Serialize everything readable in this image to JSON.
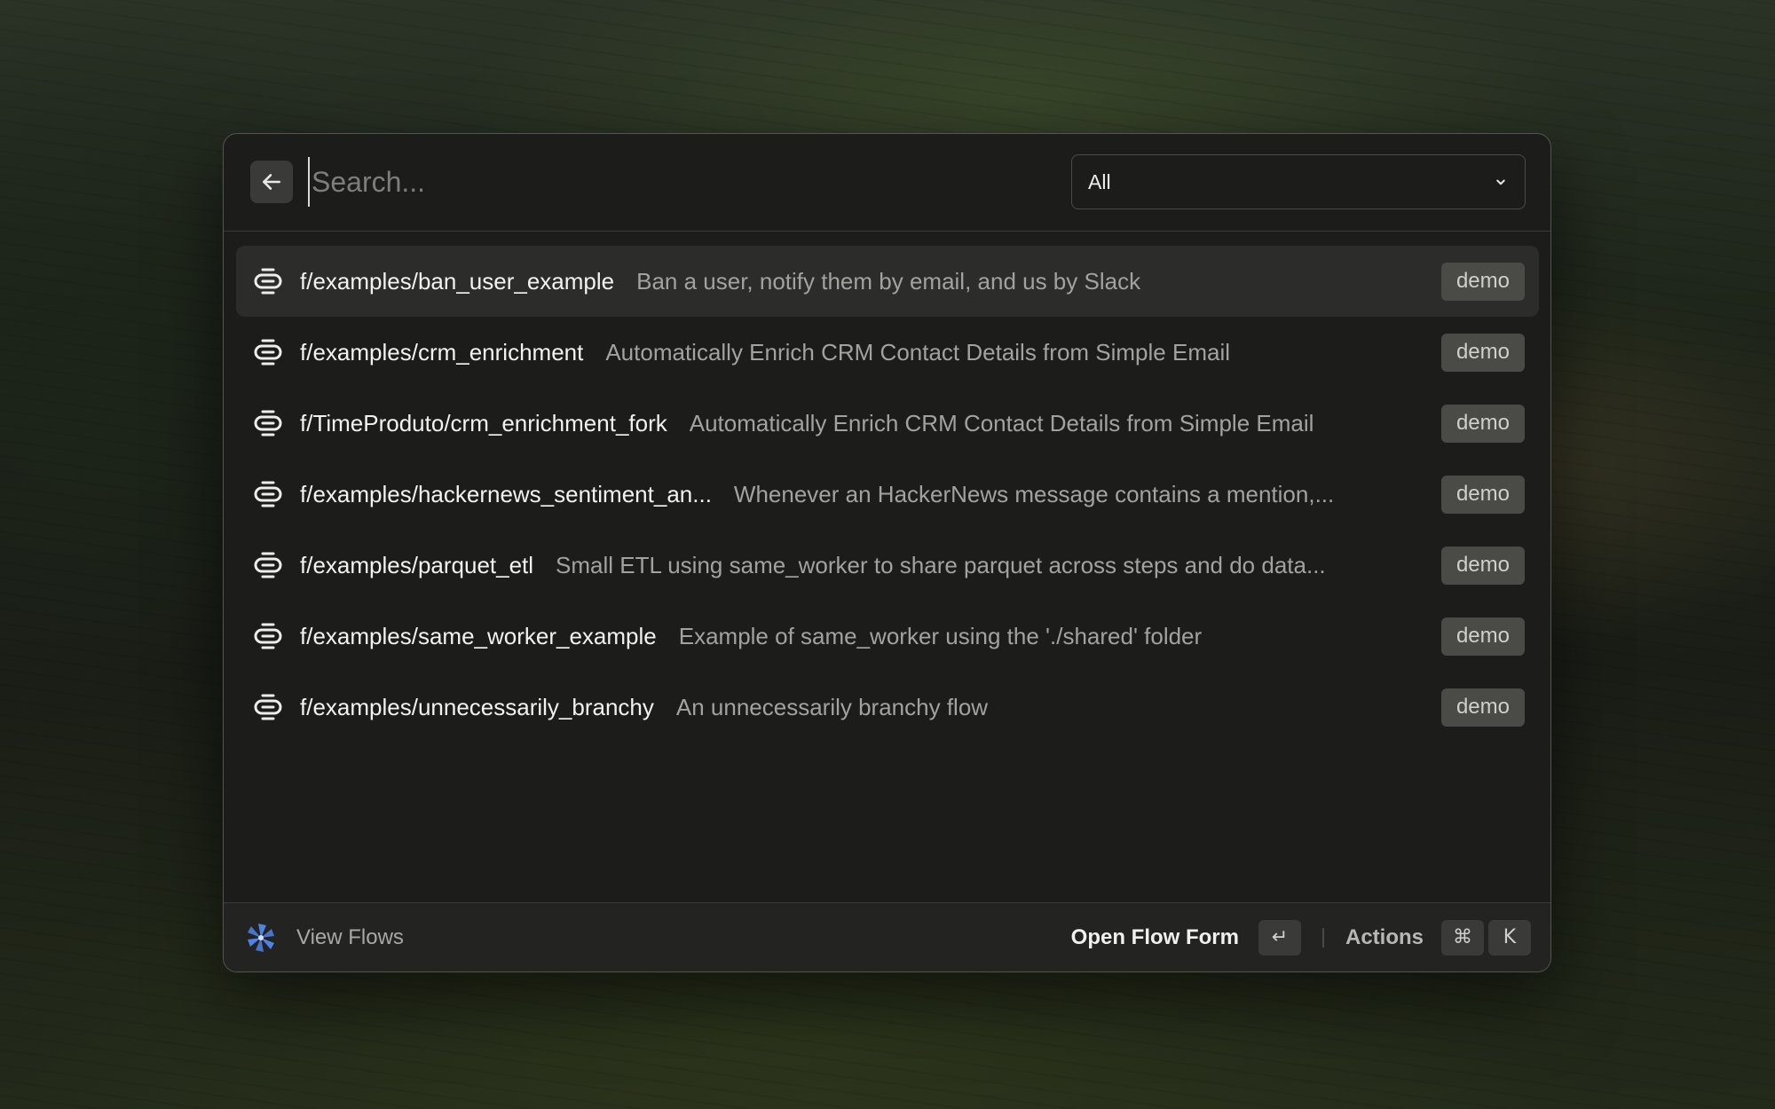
{
  "search": {
    "placeholder": "Search...",
    "value": ""
  },
  "filter": {
    "selected": "All"
  },
  "results": [
    {
      "path": "f/examples/ban_user_example",
      "description": "Ban a user, notify them by email, and us by Slack",
      "badge": "demo",
      "selected": true
    },
    {
      "path": "f/examples/crm_enrichment",
      "description": "Automatically Enrich CRM Contact Details from Simple Email",
      "badge": "demo",
      "selected": false
    },
    {
      "path": "f/TimeProduto/crm_enrichment_fork",
      "description": "Automatically Enrich CRM Contact Details from Simple Email",
      "badge": "demo",
      "selected": false
    },
    {
      "path": "f/examples/hackernews_sentiment_an...",
      "description": "Whenever an HackerNews message contains a mention,...",
      "badge": "demo",
      "selected": false
    },
    {
      "path": "f/examples/parquet_etl",
      "description": "Small ETL using same_worker to share parquet across steps and do data...",
      "badge": "demo",
      "selected": false
    },
    {
      "path": "f/examples/same_worker_example",
      "description": "Example of same_worker using the './shared' folder",
      "badge": "demo",
      "selected": false
    },
    {
      "path": "f/examples/unnecessarily_branchy",
      "description": "An unnecessarily branchy flow",
      "badge": "demo",
      "selected": false
    }
  ],
  "footer": {
    "title": "View Flows",
    "primary_action": "Open Flow Form",
    "enter_key": "↵",
    "actions_label": "Actions",
    "cmd_key": "⌘",
    "k_key": "K"
  },
  "icons": {
    "back": "arrow-left-icon",
    "chevron": "chevron-down-icon",
    "flow": "flow-icon",
    "logo": "windmill-logo-icon"
  },
  "colors": {
    "panel_bg": "#1c1c1b",
    "selected_row_bg": "#2c2c2a",
    "badge_bg": "#4a4a47",
    "logo_blue": "#4f83e8"
  }
}
